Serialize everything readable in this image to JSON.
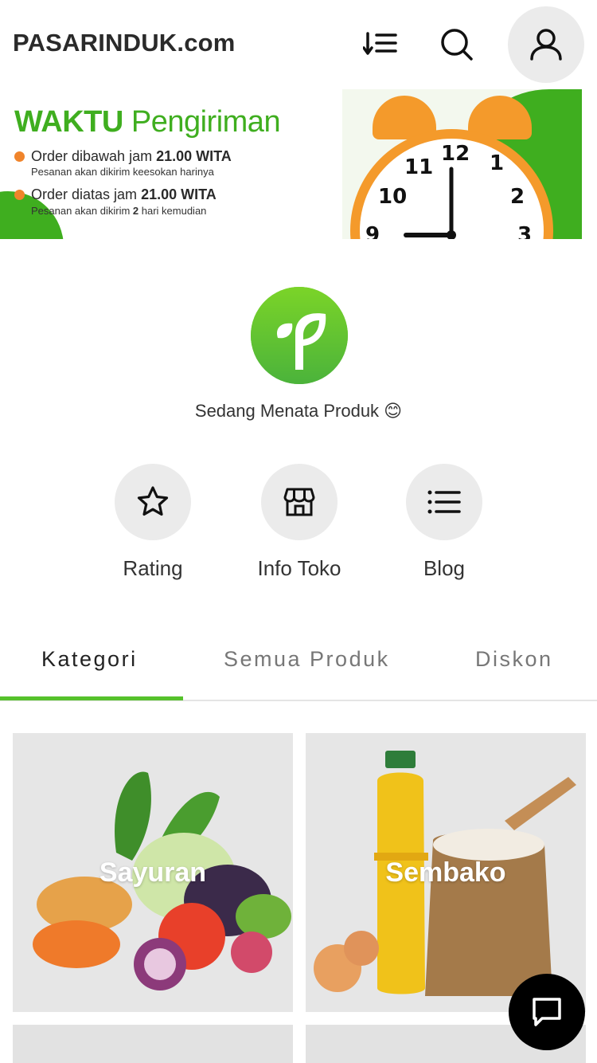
{
  "header": {
    "brand": "PASARINDUK.com",
    "icons": [
      "sort-icon",
      "search-icon",
      "user-icon"
    ]
  },
  "banner": {
    "title_bold": "WAKTU",
    "title_rest": " Pengiriman",
    "lines": [
      {
        "prefix": "Order dibawah jam ",
        "time": "21.00 WITA",
        "sub": "Pesanan akan dikirim keesokan harinya"
      },
      {
        "prefix": "Order diatas jam ",
        "time": "21.00 WITA",
        "sub_prefix": "Pesanan akan dikirim ",
        "sub_bold": "2",
        "sub_suffix": " hari kemudian"
      }
    ],
    "clock_numbers": [
      "12",
      "1",
      "2",
      "3",
      "9",
      "10",
      "11"
    ],
    "colors": {
      "green": "#3fae1f",
      "orange": "#f49a2b",
      "dot": "#f0842b"
    }
  },
  "store": {
    "tagline": "Sedang Menata Produk 😊",
    "logo_color": "#62c22f"
  },
  "actions": [
    {
      "label": "Rating",
      "icon": "star-icon"
    },
    {
      "label": "Info Toko",
      "icon": "store-icon"
    },
    {
      "label": "Blog",
      "icon": "list-icon"
    }
  ],
  "tabs": [
    {
      "label": "Kategori",
      "active": true
    },
    {
      "label": "Semua Produk",
      "active": false
    },
    {
      "label": "Diskon",
      "active": false
    }
  ],
  "categories": [
    {
      "label": "Sayuran"
    },
    {
      "label": "Sembako"
    }
  ],
  "chat": {
    "icon": "chat-icon"
  }
}
